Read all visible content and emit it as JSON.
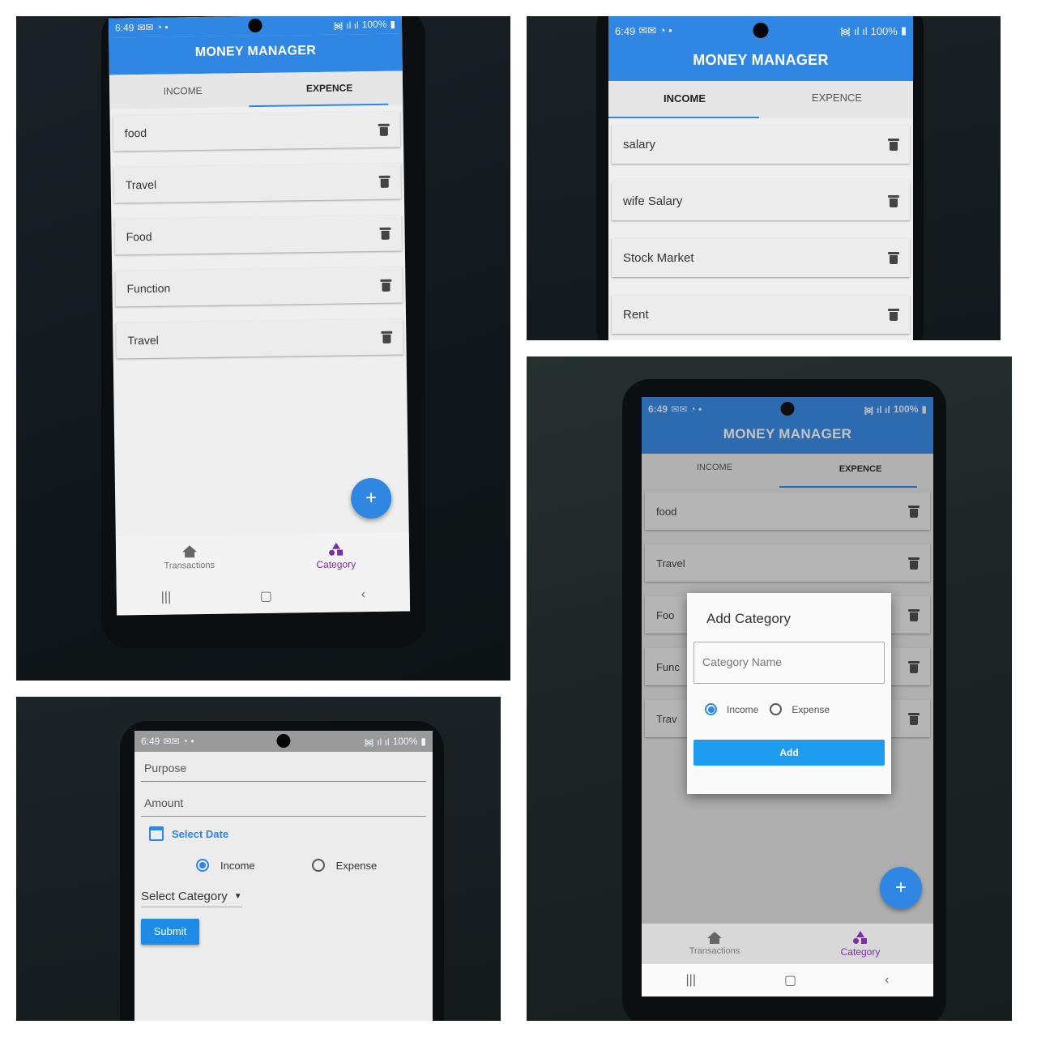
{
  "status": {
    "time": "6:49",
    "battery": "100%"
  },
  "app_title": "MONEY MANAGER",
  "tabs": {
    "income": "INCOME",
    "expense": "EXPENCE"
  },
  "expense_categories": [
    "food",
    "Travel",
    "Food",
    "Function",
    "Travel"
  ],
  "income_categories": [
    "salary",
    "wife Salary",
    "Stock Market",
    "Rent"
  ],
  "bottom_nav": {
    "transactions": "Transactions",
    "category": "Category"
  },
  "fab_label": "+",
  "transaction_form": {
    "purpose_placeholder": "Purpose",
    "amount_placeholder": "Amount",
    "select_date": "Select Date",
    "income": "Income",
    "expense": "Expense",
    "select_category": "Select Category",
    "submit": "Submit"
  },
  "add_category_dialog": {
    "title": "Add Category",
    "name_placeholder": "Category Name",
    "income": "Income",
    "expense": "Expense",
    "add": "Add"
  },
  "background_partial": [
    "food",
    "Travel",
    "Foo",
    "Func",
    "Trav"
  ],
  "colors": {
    "app_bar": "#2f86e3",
    "accent": "#7b2ea6",
    "dialog_button": "#1e9cf0"
  }
}
